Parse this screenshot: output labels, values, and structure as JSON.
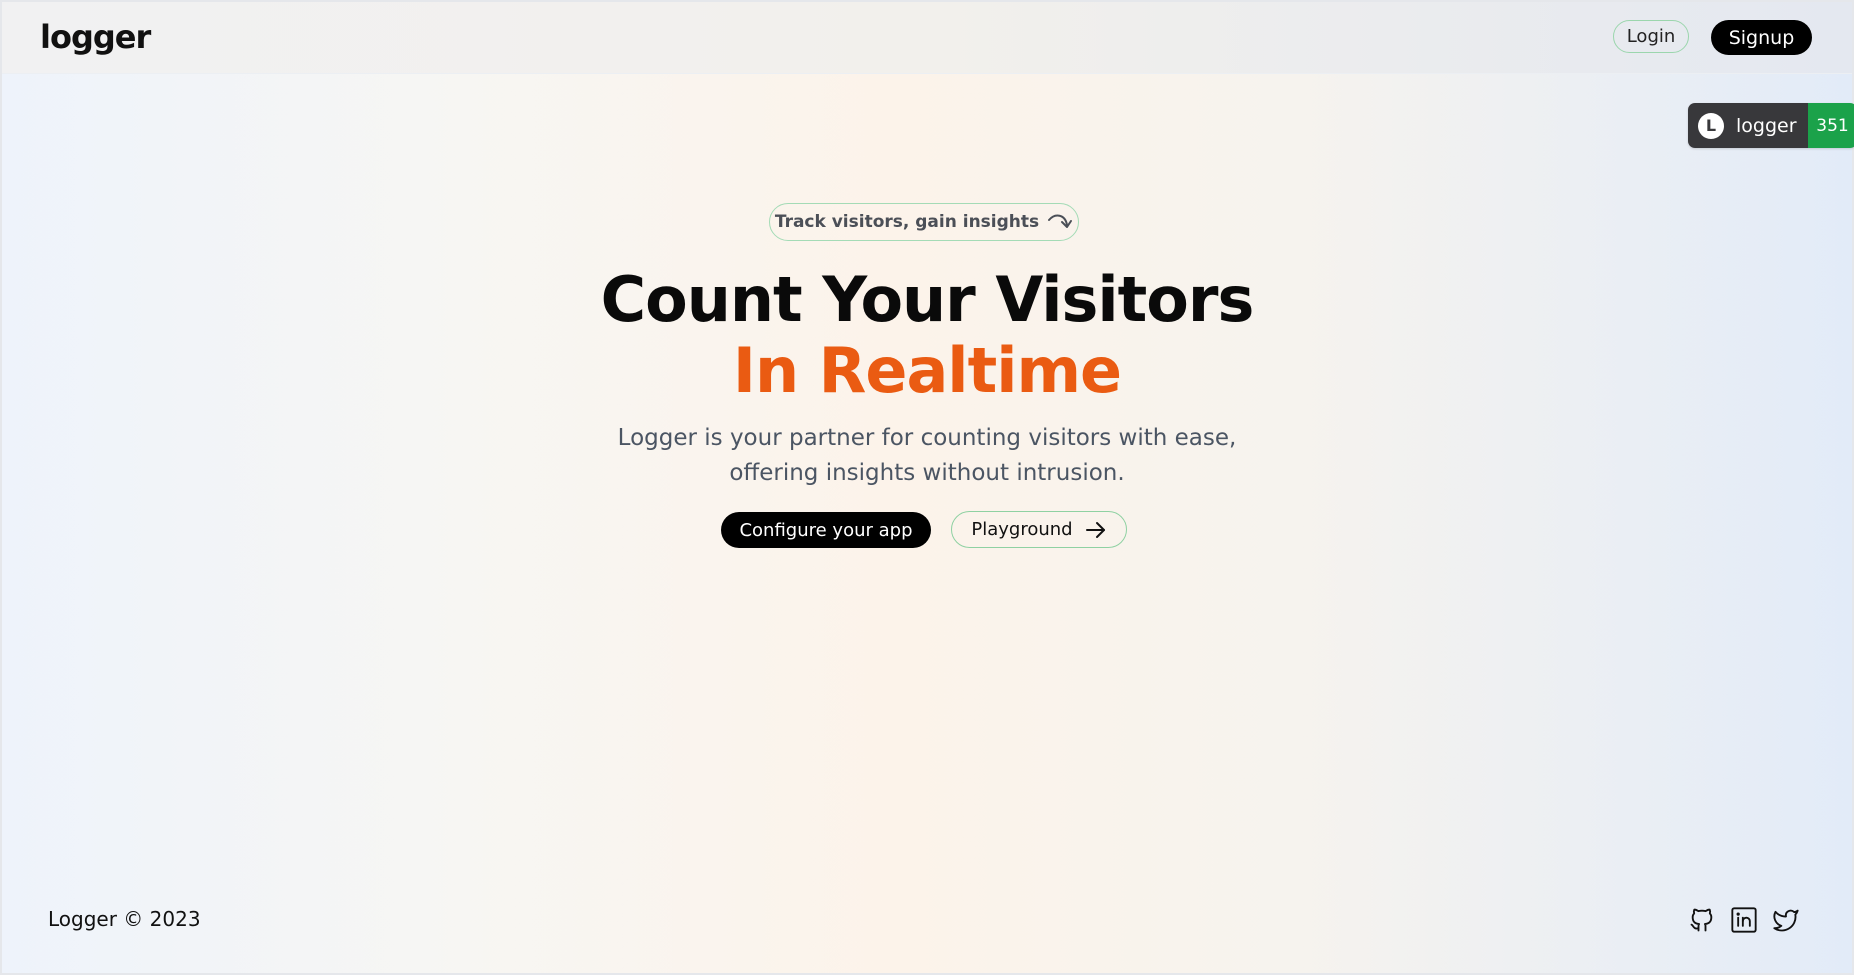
{
  "header": {
    "logo": "logger",
    "login_label": "Login",
    "signup_label": "Signup"
  },
  "counter_badge": {
    "logo_letter": "L",
    "label": "logger",
    "count": "351"
  },
  "hero": {
    "pill_label": "Track visitors, gain insights",
    "title_line1": "Count Your Visitors",
    "title_line2": "In Realtime",
    "description": "Logger is your partner for counting visitors with ease, offering insights without intrusion.",
    "primary_button": "Configure your app",
    "secondary_button": "Playground"
  },
  "footer": {
    "copyright": "Logger © 2023",
    "social_icons": [
      "github-icon",
      "linkedin-icon",
      "twitter-icon"
    ]
  },
  "colors": {
    "accent": "#ea5b12",
    "badge_green": "#1ba24a",
    "pill_border": "#a4dbb6",
    "primary_button_bg": "#000000"
  }
}
